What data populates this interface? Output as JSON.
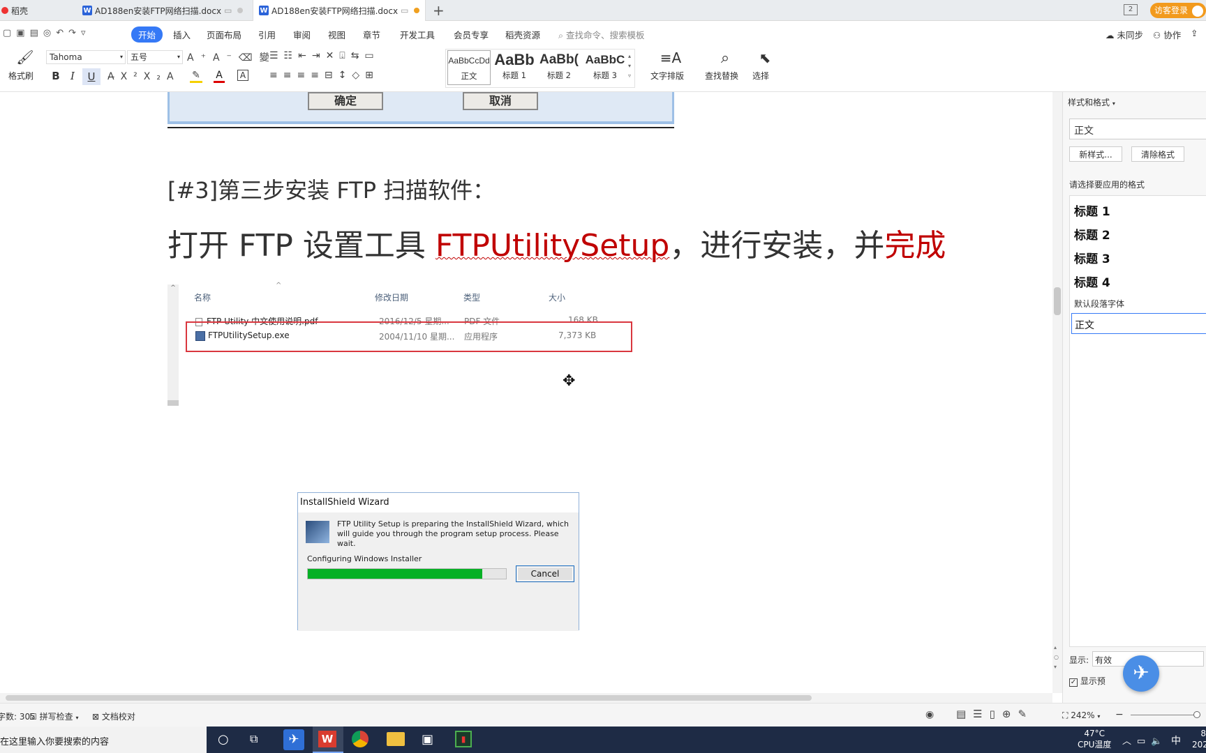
{
  "tabs": [
    {
      "label": "稻壳"
    },
    {
      "label": "AD188en安装FTP网络扫描.docx"
    },
    {
      "label": "AD188en安装FTP网络扫描.docx"
    }
  ],
  "tabbar": {
    "new_tab": "+",
    "badge": "2",
    "login": "访客登录"
  },
  "menu": {
    "items": [
      "开始",
      "插入",
      "页面布局",
      "引用",
      "审阅",
      "视图",
      "章节",
      "开发工具",
      "会员专享",
      "稻壳资源"
    ],
    "search_placeholder": "查找命令、搜索模板",
    "sync": "未同步",
    "collab": "协作"
  },
  "ribbon": {
    "format_painter": "格式刷",
    "font_name": "Tahoma",
    "font_size": "五号",
    "styles": [
      {
        "preview": "AaBbCcDd",
        "name": "正文"
      },
      {
        "preview": "AaBb",
        "name": "标题 1"
      },
      {
        "preview": "AaBb(",
        "name": "标题 2"
      },
      {
        "preview": "AaBbC",
        "name": "标题 3"
      }
    ],
    "text_layout": "文字排版",
    "find_replace": "查找替换",
    "select": "选择"
  },
  "document": {
    "dialog_ok": "确定",
    "dialog_cancel": "取消",
    "step_heading": "[#3]第三步安装 FTP 扫描软件：",
    "line_part1": "打开 FTP 设置工具 ",
    "line_red": "FTPUtilitySetup",
    "line_part2": "，进行安装，并",
    "line_red2": "完成",
    "explorer": {
      "columns": [
        "名称",
        "修改日期",
        "类型",
        "大小"
      ],
      "rows": [
        {
          "name": "FTP Utility 中文使用说明.pdf",
          "date": "2016/12/5 星期...",
          "type": "PDF 文件",
          "size": "168 KB"
        },
        {
          "name": "FTPUtilitySetup.exe",
          "date": "2004/11/10 星期...",
          "type": "应用程序",
          "size": "7,373 KB"
        }
      ]
    },
    "wizard": {
      "title": "InstallShield Wizard",
      "message": "FTP Utility Setup is preparing the InstallShield Wizard, which will guide you through the program setup process.  Please wait.",
      "status": "Configuring Windows Installer",
      "progress": 0.88,
      "cancel": "Cancel"
    }
  },
  "sidepane": {
    "title": "样式和格式",
    "current": "正文",
    "new_style": "新样式...",
    "clear_format": "清除格式",
    "prompt": "请选择要应用的格式",
    "styles": [
      "标题 1",
      "标题 2",
      "标题 3",
      "标题 4"
    ],
    "default_font": "默认段落字体",
    "selected": "正文",
    "show_label": "显示:",
    "show_value": "有效",
    "show_preview": "显示预"
  },
  "status": {
    "word_count": "字数: 305",
    "spell": "拼写检查",
    "doc_check": "文档校对",
    "zoom": "242%"
  },
  "taskbar": {
    "search": "在这里输入你要搜索的内容",
    "temp": "47°C",
    "temp_label": "CPU温度",
    "ime": "中",
    "time": "8",
    "date": "202"
  },
  "colors": {
    "accent": "#3579f6",
    "red_text": "#c00000",
    "progress": "#06b025",
    "highlight_box": "#d9363e"
  }
}
